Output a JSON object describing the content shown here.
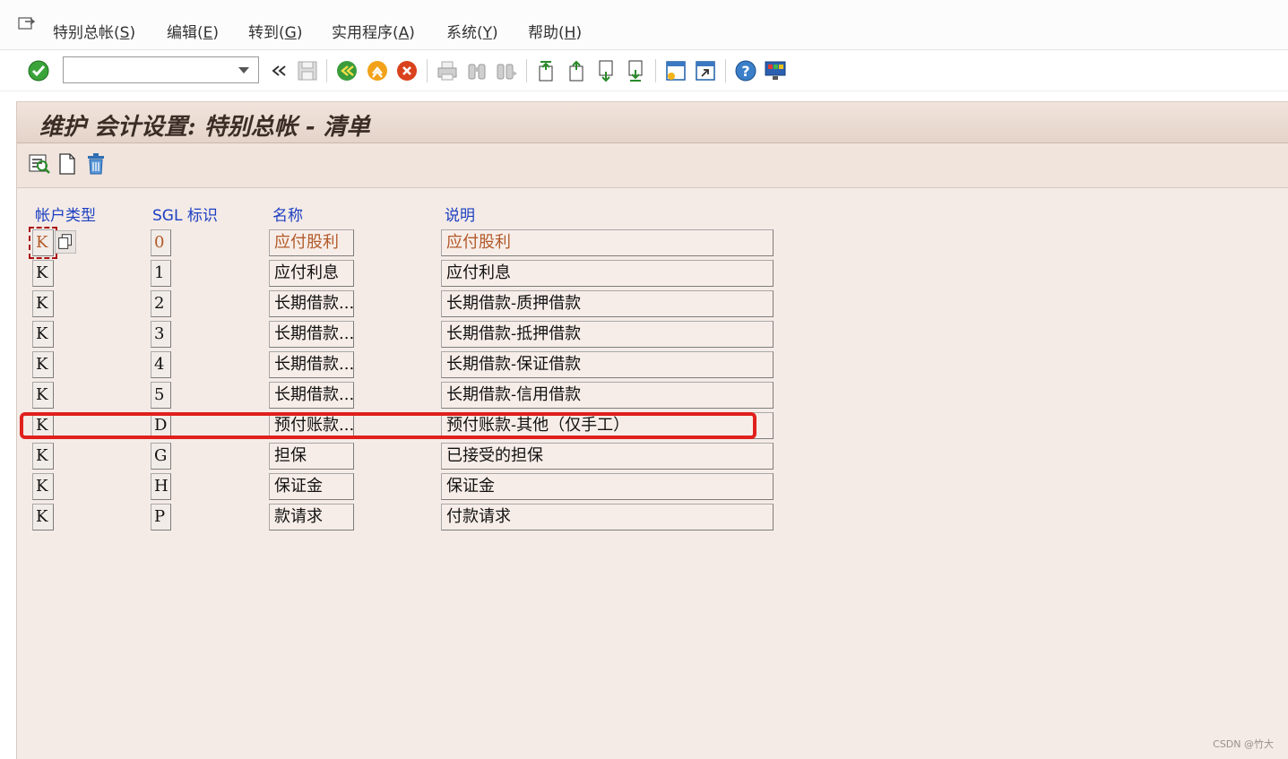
{
  "menubar": {
    "items": [
      {
        "text": "特别总帐(",
        "accel": "S",
        "close": ")"
      },
      {
        "text": "编辑(",
        "accel": "E",
        "close": ")"
      },
      {
        "text": "转到(",
        "accel": "G",
        "close": ")"
      },
      {
        "text": "实用程序(",
        "accel": "A",
        "close": ")"
      },
      {
        "text": "系统(",
        "accel": "Y",
        "close": ")"
      },
      {
        "text": "帮助(",
        "accel": "H",
        "close": ")"
      }
    ]
  },
  "toolbar": {
    "command_field_value": "",
    "icons": [
      "enter-icon",
      "back-arrows-icon",
      "save-icon",
      "back-icon",
      "exit-icon",
      "cancel-icon",
      "print-icon",
      "find-icon",
      "find-next-icon",
      "first-page-icon",
      "previous-page-icon",
      "next-page-icon",
      "last-page-icon",
      "new-session-icon",
      "shortcut-icon",
      "help-icon",
      "layout-menu-icon"
    ]
  },
  "page": {
    "title": "维护 会计设置: 特别总帐 - 清单"
  },
  "app_toolbar": {
    "icons": [
      "details-icon",
      "create-icon",
      "delete-icon"
    ]
  },
  "table": {
    "headers": [
      "帐户类型",
      "SGL 标识",
      "名称",
      "说明"
    ],
    "rows": [
      {
        "account_type": "K",
        "sgl": "0",
        "name": "应付股利",
        "description": "应付股利"
      },
      {
        "account_type": "K",
        "sgl": "1",
        "name": "应付利息",
        "description": "应付利息"
      },
      {
        "account_type": "K",
        "sgl": "2",
        "name": "长期借款...",
        "description": "长期借款-质押借款"
      },
      {
        "account_type": "K",
        "sgl": "3",
        "name": "长期借款...",
        "description": "长期借款-抵押借款"
      },
      {
        "account_type": "K",
        "sgl": "4",
        "name": "长期借款...",
        "description": "长期借款-保证借款"
      },
      {
        "account_type": "K",
        "sgl": "5",
        "name": "长期借款...",
        "description": "长期借款-信用借款"
      },
      {
        "account_type": "K",
        "sgl": "D",
        "name": "预付账款...",
        "description": "预付账款-其他（仅手工）"
      },
      {
        "account_type": "K",
        "sgl": "G",
        "name": "担保",
        "description": "已接受的担保"
      },
      {
        "account_type": "K",
        "sgl": "H",
        "name": "保证金",
        "description": "保证金"
      },
      {
        "account_type": "K",
        "sgl": "P",
        "name": "款请求",
        "description": "付款请求"
      }
    ],
    "highlighted_row": 6
  },
  "watermark": "CSDN @竹大",
  "colors": {
    "background": "#f4ebe7",
    "header_text": "#1c3fc1",
    "highlight": "#e0201c",
    "first_row_text": "#b25a2a"
  }
}
